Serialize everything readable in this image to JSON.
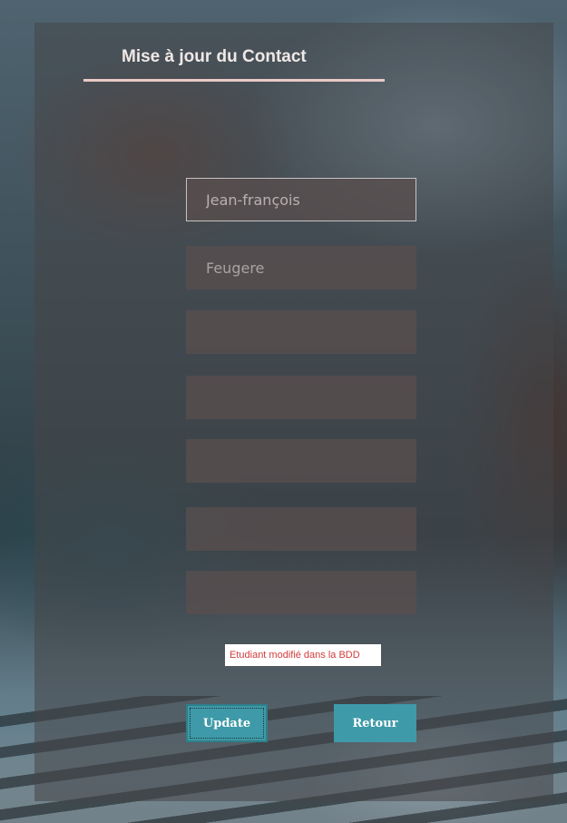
{
  "form": {
    "title": "Mise à jour du Contact",
    "fields": [
      {
        "value": "Jean-françois",
        "placeholder": ""
      },
      {
        "value": "Feugere",
        "placeholder": ""
      },
      {
        "value": "",
        "placeholder": ""
      },
      {
        "value": "",
        "placeholder": ""
      },
      {
        "value": "",
        "placeholder": ""
      },
      {
        "value": "",
        "placeholder": ""
      },
      {
        "value": "",
        "placeholder": ""
      }
    ],
    "status_message": "Etudiant modifié dans la BDD",
    "update_label": "Update",
    "retour_label": "Retour"
  },
  "colors": {
    "accent": "#3e9aa8",
    "title_underline": "#e9c9c6",
    "status_text": "#d23b3b"
  }
}
